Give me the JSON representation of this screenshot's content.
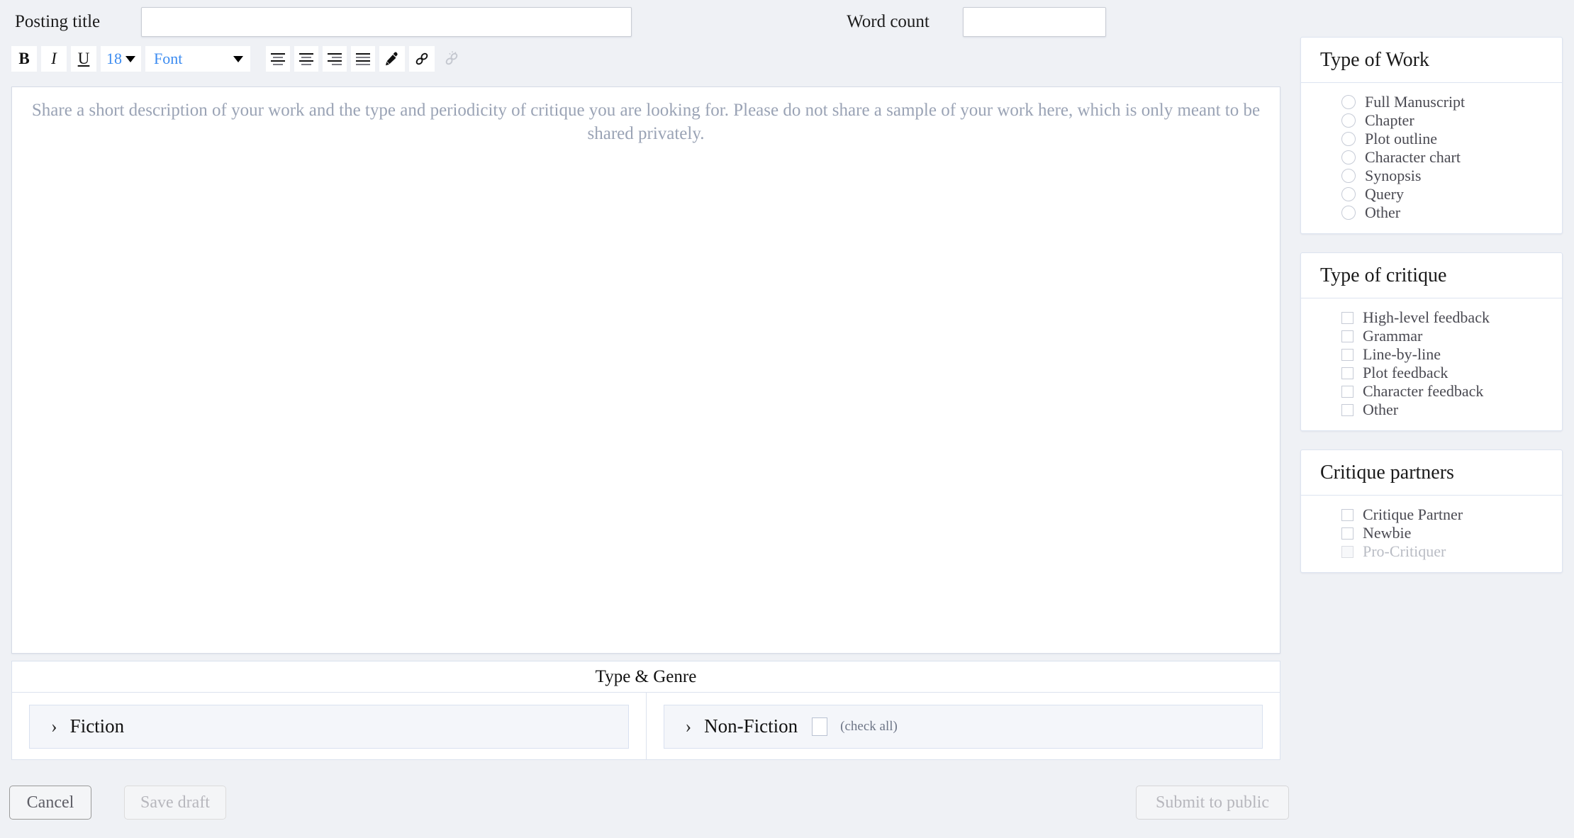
{
  "form": {
    "posting_title_label": "Posting title",
    "posting_title_value": "",
    "posting_title_placeholder": "",
    "word_count_label": "Word count",
    "word_count_value": "",
    "word_count_placeholder": ""
  },
  "toolbar": {
    "bold": "B",
    "italic": "I",
    "underline": "U",
    "font_size": "18",
    "font_family": "Font",
    "accent_color": "#3b8bf0",
    "icons": {
      "align_left": "align-left-icon",
      "align_center": "align-center-icon",
      "align_right": "align-right-icon",
      "align_justify": "align-justify-icon",
      "highlight": "pen-icon",
      "link": "link-icon",
      "unlink": "unlink-icon"
    }
  },
  "editor": {
    "placeholder": "Share a short description of your work and the type and periodicity of critique you are looking for. Please do not share a sample of your work here, which is only meant to be shared privately.",
    "content": ""
  },
  "genre": {
    "title": "Type & Genre",
    "fiction": {
      "label": "Fiction",
      "chevron": "›"
    },
    "nonfiction": {
      "label": "Non-Fiction",
      "chevron": "›",
      "check_all_label": "(check all)",
      "check_all_checked": false
    }
  },
  "sidebar": {
    "panels": [
      {
        "title": "Type of Work",
        "control": "radio",
        "options": [
          {
            "label": "Full Manuscript",
            "selected": false,
            "disabled": false
          },
          {
            "label": "Chapter",
            "selected": false,
            "disabled": false
          },
          {
            "label": "Plot outline",
            "selected": false,
            "disabled": false
          },
          {
            "label": "Character chart",
            "selected": false,
            "disabled": false
          },
          {
            "label": "Synopsis",
            "selected": false,
            "disabled": false
          },
          {
            "label": "Query",
            "selected": false,
            "disabled": false
          },
          {
            "label": "Other",
            "selected": false,
            "disabled": false
          }
        ]
      },
      {
        "title": "Type of critique",
        "control": "checkbox",
        "options": [
          {
            "label": "High-level feedback",
            "selected": false,
            "disabled": false
          },
          {
            "label": "Grammar",
            "selected": false,
            "disabled": false
          },
          {
            "label": "Line-by-line",
            "selected": false,
            "disabled": false
          },
          {
            "label": "Plot feedback",
            "selected": false,
            "disabled": false
          },
          {
            "label": "Character feedback",
            "selected": false,
            "disabled": false
          },
          {
            "label": "Other",
            "selected": false,
            "disabled": false
          }
        ]
      },
      {
        "title": "Critique partners",
        "control": "checkbox",
        "options": [
          {
            "label": "Critique Partner",
            "selected": false,
            "disabled": false
          },
          {
            "label": "Newbie",
            "selected": false,
            "disabled": false
          },
          {
            "label": "Pro-Critiquer",
            "selected": false,
            "disabled": true
          }
        ]
      }
    ]
  },
  "footer": {
    "cancel": "Cancel",
    "save_draft": "Save draft",
    "submit": "Submit to public"
  }
}
